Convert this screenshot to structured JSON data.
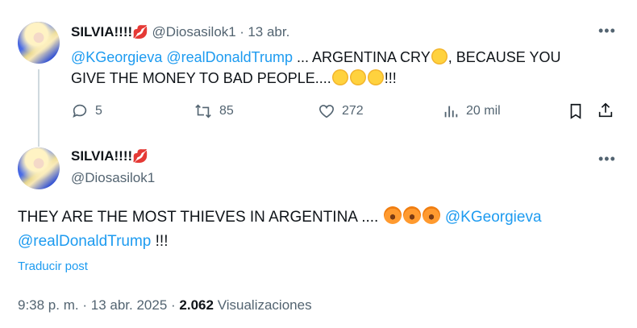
{
  "reply_tweet": {
    "display_name": "SILVIA!!!!",
    "name_emoji": "lips-icon",
    "handle": "@Diosasilok1",
    "separator": "·",
    "date": "13 abr.",
    "mention_1": "@KGeorgieva",
    "mention_2": "@realDonaldTrump",
    "text_part_1": " ... ARGENTINA CRY",
    "text_part_2": ", BECAUSE YOU",
    "text_line_2": "GIVE THE MONEY TO BAD PEOPLE....",
    "text_end": "!!!",
    "actions": {
      "replies": "5",
      "reposts": "85",
      "likes": "272",
      "views": "20 mil"
    }
  },
  "main_tweet": {
    "display_name": "SILVIA!!!!",
    "handle": "@Diosasilok1",
    "text_part_1": "THEY ARE THE MOST THIEVES IN ARGENTINA .... ",
    "mention_1": "@KGeorgieva",
    "mention_2": "@realDonaldTrump",
    "text_end": " !!!",
    "translate_label": "Traducir post",
    "time": "9:38 p. m.",
    "separator": "·",
    "date": "13 abr. 2025",
    "separator_2": "·",
    "views_count": "2.062",
    "views_label": "Visualizaciones"
  },
  "colors": {
    "link": "#1d9bf0",
    "text": "#0f1419",
    "secondary": "#536471",
    "line": "#cfd9de"
  }
}
